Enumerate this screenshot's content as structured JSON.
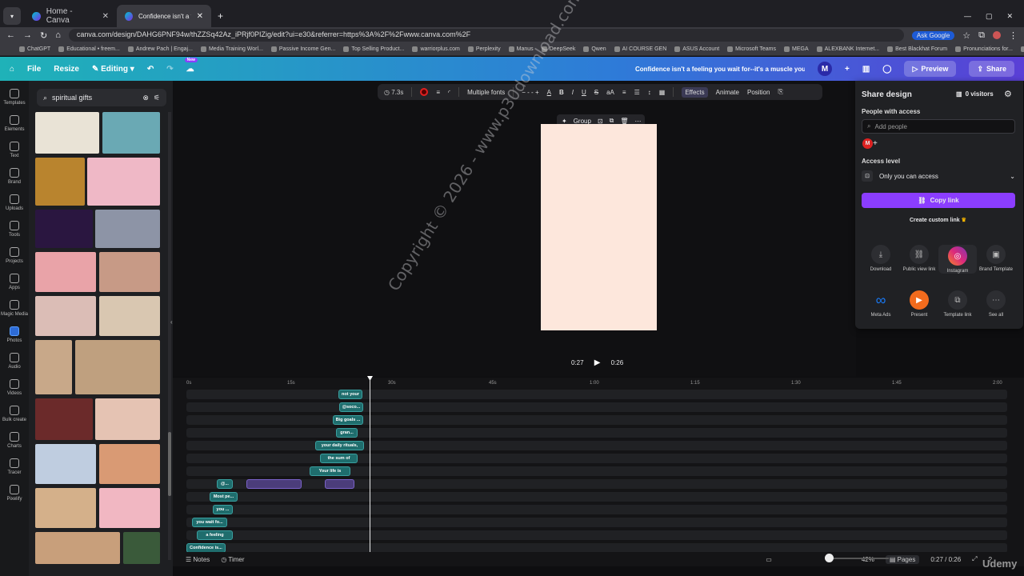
{
  "browser": {
    "tabs": [
      {
        "title": "Home - Canva"
      },
      {
        "title": "Confidence isn't a feeling you w..."
      }
    ],
    "url": "canva.com/design/DAHG6PNF94w/thZZSq42Az_iPRjf0PIZig/edit?ui=e30&referrer=https%3A%2F%2Fwww.canva.com%2F",
    "ask_google": "Ask Google",
    "bookmarks": [
      "ChatGPT",
      "Educational • freem...",
      "Andrew Pach | Engaj...",
      "Media Training Worl...",
      "Passive Income Gen...",
      "Top Selling Product...",
      "warriorplus.com",
      "Perplexity",
      "Manus",
      "DeepSeek",
      "Qwen",
      "AI COURSE GEN",
      "ASUS Account",
      "Microsoft Teams",
      "MEGA",
      "ALEXBANK Internet...",
      "Best Blackhat Forum",
      "Pronunciations for...",
      "Etsy - Shop Dashbo..."
    ]
  },
  "header": {
    "file": "File",
    "resize": "Resize",
    "editing": "Editing",
    "new_badge": "New",
    "doc_title": "Confidence isn't a feeling you wait for--it's a muscle you bui...",
    "avatar": "M",
    "preview": "Preview",
    "share": "Share"
  },
  "rail": [
    {
      "label": "Templates"
    },
    {
      "label": "Elements"
    },
    {
      "label": "Text"
    },
    {
      "label": "Brand"
    },
    {
      "label": "Uploads"
    },
    {
      "label": "Tools"
    },
    {
      "label": "Projects"
    },
    {
      "label": "Apps"
    },
    {
      "label": "Magic Media"
    },
    {
      "label": "Photos"
    },
    {
      "label": "Audio"
    },
    {
      "label": "Videos"
    },
    {
      "label": "Bulk create"
    },
    {
      "label": "Charts"
    },
    {
      "label": "Tracer"
    },
    {
      "label": "Pixelify"
    }
  ],
  "panel": {
    "search_value": "spiritual gifts"
  },
  "toolbar": {
    "duration": "7.3s",
    "font": "Multiple fonts",
    "size": "- -",
    "effects": "Effects",
    "animate": "Animate",
    "position": "Position"
  },
  "group_bar": {
    "label": "Group"
  },
  "canvas": {
    "watermark": "Copyright © 2026 - www.p30download.com"
  },
  "playback": {
    "current": "0:27",
    "total": "0:26"
  },
  "share_panel": {
    "title": "Share design",
    "visitors": "0 visitors",
    "people_label": "People with access",
    "add_people_placeholder": "Add people",
    "avatar": "M",
    "access_label": "Access level",
    "access_value": "Only you can access",
    "copy_link": "Copy link",
    "custom_link": "Create custom link",
    "options": [
      {
        "label": "Download",
        "icon": "download-icon"
      },
      {
        "label": "Public view link",
        "icon": "link-icon"
      },
      {
        "label": "Instagram",
        "icon": "instagram-icon"
      },
      {
        "label": "Brand Template",
        "icon": "template-icon"
      },
      {
        "label": "Meta Ads",
        "icon": "meta-icon"
      },
      {
        "label": "Present",
        "icon": "present-icon"
      },
      {
        "label": "Template link",
        "icon": "template-link-icon"
      },
      {
        "label": "See all",
        "icon": "more-icon"
      }
    ]
  },
  "timeline": {
    "ticks": [
      "0s",
      "15s",
      "30s",
      "45s",
      "1:00",
      "1:15",
      "1:30",
      "1:45",
      "2:00"
    ],
    "clips": [
      "not your",
      "@soco...",
      "Big goals ...",
      "gran...",
      "your daily rituals,",
      "the sum of",
      "Your life is",
      "@...",
      "Most pe...",
      "you ...",
      "you wait fo...",
      "a feeling",
      "Confidence is..."
    ]
  },
  "status": {
    "notes": "Notes",
    "timer": "Timer",
    "zoom": "42%",
    "pages": "Pages",
    "time": "0:27 / 0:26",
    "watermark": "Udemy"
  }
}
